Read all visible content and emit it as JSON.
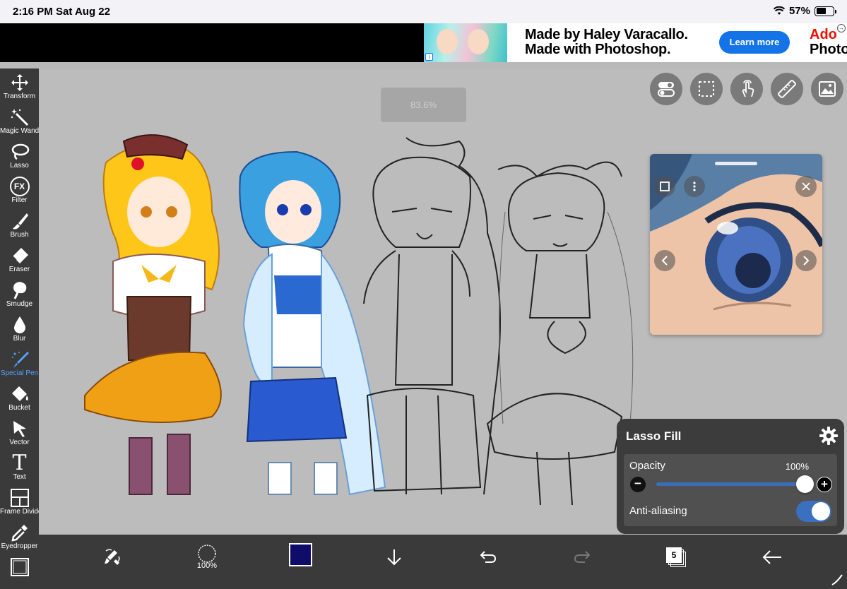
{
  "status_bar": {
    "time": "2:16 PM",
    "date": "Sat Aug 22",
    "battery": "57%",
    "battery_level": 0.57
  },
  "ad": {
    "headline": "Made by Haley Varacallo. Made with Photoshop.",
    "cta": "Learn more",
    "brand_line1": "Ado",
    "brand_line2": "Photo",
    "info_glyph": "i",
    "choice_glyph": "→"
  },
  "toolbar": {
    "tools": [
      {
        "label": "Transform",
        "icon": "move-arrows-icon"
      },
      {
        "label": "Magic Wand",
        "icon": "magic-wand-icon"
      },
      {
        "label": "Lasso",
        "icon": "lasso-icon"
      },
      {
        "label": "Filter",
        "icon": "fx-icon"
      },
      {
        "label": "Brush",
        "icon": "brush-icon"
      },
      {
        "label": "Eraser",
        "icon": "eraser-icon"
      },
      {
        "label": "Smudge",
        "icon": "smudge-icon"
      },
      {
        "label": "Blur",
        "icon": "blur-drop-icon"
      },
      {
        "label": "Special Pen",
        "icon": "special-pen-icon",
        "active": true
      },
      {
        "label": "Bucket",
        "icon": "bucket-icon"
      },
      {
        "label": "Vector",
        "icon": "vector-cursor-icon"
      },
      {
        "label": "Text",
        "icon": "text-icon"
      },
      {
        "label": "Frame Divider",
        "icon": "frame-divider-icon"
      },
      {
        "label": "Eyedropper",
        "icon": "eyedropper-icon"
      },
      {
        "label": "",
        "icon": "canvas-icon"
      }
    ],
    "fx_glyph": "FX",
    "text_glyph": "T"
  },
  "canvas": {
    "zoom": "83.6%"
  },
  "top_buttons": [
    "toggle-settings-icon",
    "selection-icon",
    "touch-icon",
    "ruler-icon",
    "reference-image-icon"
  ],
  "lasso_panel": {
    "title": "Lasso Fill",
    "opacity_label": "Opacity",
    "opacity_value": "100%",
    "opacity_level": 1.0,
    "anti_aliasing_label": "Anti-aliasing",
    "anti_aliasing_on": true,
    "minus": "−",
    "plus": "+"
  },
  "bottom_toolbar": {
    "brush_size": "100%",
    "current_color": "#100c6a",
    "layers_count": "5"
  },
  "colors": {
    "accent": "#3b6fbf",
    "toolbar_bg": "#3a3a3a",
    "canvas_bg": "#bcbcbc",
    "active_tool": "#5aa0ff"
  }
}
